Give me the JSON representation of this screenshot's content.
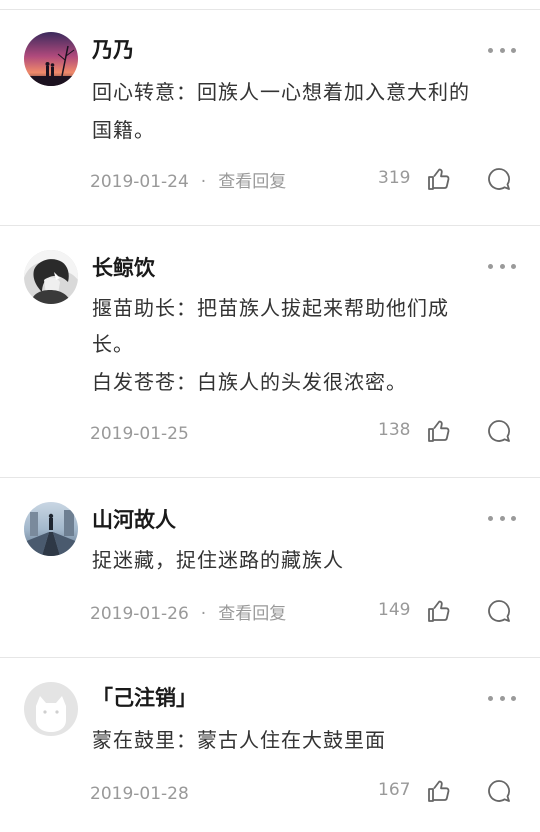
{
  "comments": [
    {
      "username": "乃乃",
      "lines": [
        "回心转意：回族人一心想着加入意大利的",
        "国籍。"
      ],
      "date": "2019-01-24",
      "separator": "·",
      "view_replies": "查看回复",
      "likes": "319",
      "avatar_icon": "sunset-silhouette-avatar"
    },
    {
      "username": "长鲸饮",
      "lines": [
        "揠苗助长：把苗族人拔起来帮助他们成",
        "长。",
        "白发苍苍：白族人的头发很浓密。"
      ],
      "date": "2019-01-25",
      "separator": "",
      "view_replies": "",
      "likes": "138",
      "avatar_icon": "anime-character-avatar"
    },
    {
      "username": "山河故人",
      "lines": [
        "捉迷藏，捉住迷路的藏族人"
      ],
      "date": "2019-01-26",
      "separator": "·",
      "view_replies": "查看回复",
      "likes": "149",
      "avatar_icon": "road-landscape-avatar"
    },
    {
      "username": "「己注销」",
      "lines": [
        "蒙在鼓里：蒙古人住在大鼓里面"
      ],
      "date": "2019-01-28",
      "separator": "",
      "view_replies": "",
      "likes": "167",
      "avatar_icon": "default-cat-avatar"
    }
  ],
  "colors": {
    "username": "#1a1a1a",
    "body_text": "#333333",
    "meta_text": "#999999",
    "divider": "#e6e6e6"
  }
}
